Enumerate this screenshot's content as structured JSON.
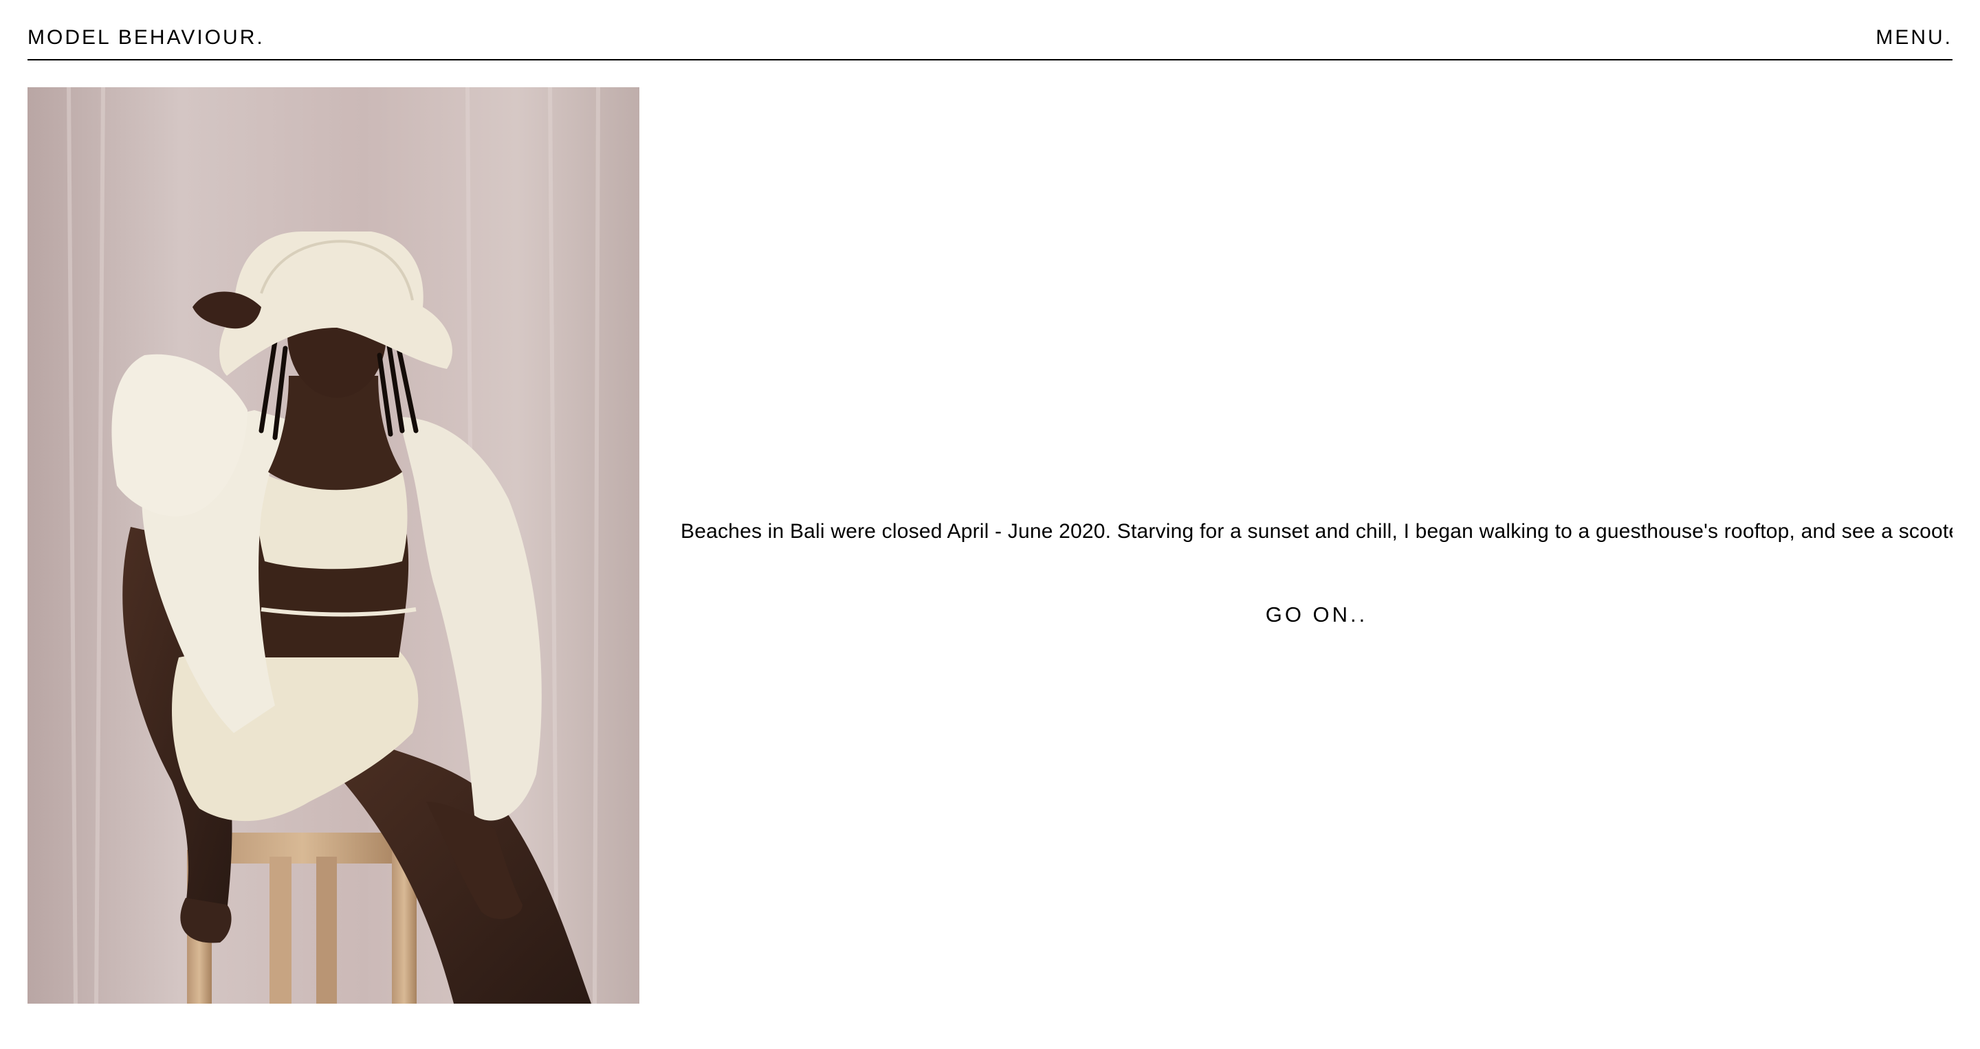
{
  "header": {
    "brand": "MODEL BEHAVIOUR.",
    "menu_label": "MENU."
  },
  "post": {
    "excerpt": "Beaches in Bali were closed April - June 2020. Starving for a sunset and chill, I began walking to a guesthouse's rooftop, and see a scooter m",
    "cta_label": "GO ON.."
  },
  "colors": {
    "text": "#000000",
    "background": "#ffffff",
    "photo_backdrop": "#c9b8b8"
  }
}
